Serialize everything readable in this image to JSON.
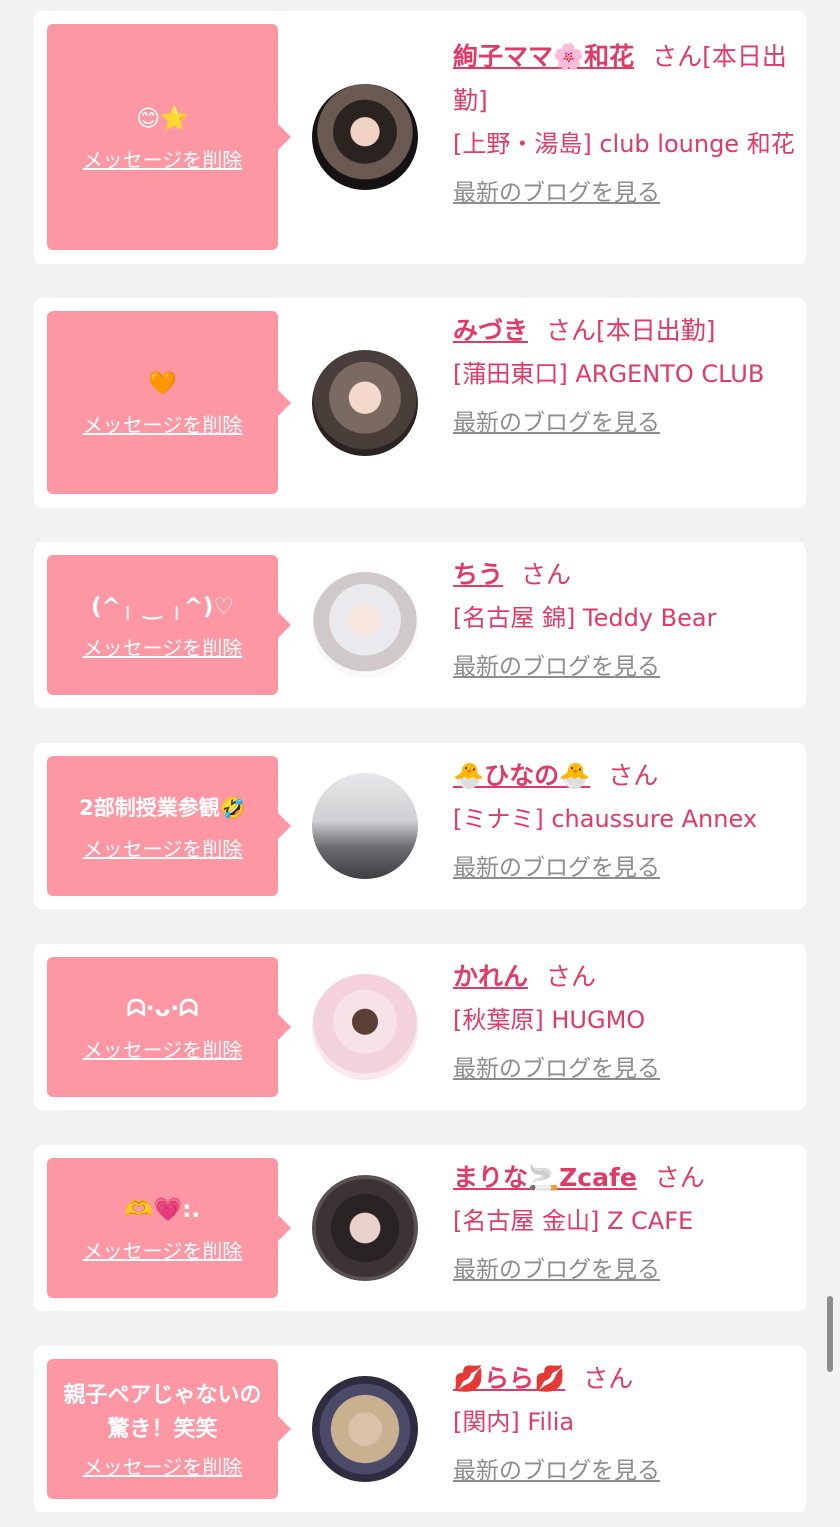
{
  "delete_label": "メッセージを削除",
  "blog_label": "最新のブログを見る",
  "suffix": "さん",
  "colors": {
    "bubble": "#fe97a4",
    "accent": "#e03a66",
    "link_gray": "#8d8d8d",
    "background": "#f2f2f2"
  },
  "cards": [
    {
      "message": "😊⭐",
      "name": "絢子ママ🌸和花",
      "status": "[本日出勤]",
      "shop": "[上野・湯島] club lounge 和花"
    },
    {
      "message": "🧡",
      "name": "みづき",
      "status": "[本日出勤]",
      "shop": "[蒲田東口] ARGENTO CLUB"
    },
    {
      "message": "(^╷ ‿ ╷^)♡",
      "name": "ちう",
      "status": "",
      "shop": "[名古屋 錦] Teddy Bear"
    },
    {
      "message": "2部制授業参観🤣",
      "name": "🐣ひなの🐣",
      "status": "",
      "shop": "[ミナミ] chaussure Annex"
    },
    {
      "message": "ᗣ·ᴗ·ᗣ",
      "name": "かれん",
      "status": "",
      "shop": "[秋葉原] HUGMO"
    },
    {
      "message": "🫶💗:.",
      "name": "まりな🚬Zcafe",
      "status": "",
      "shop": "[名古屋 金山] Z CAFE"
    },
    {
      "message": "親子ペアじゃないの驚き！笑笑",
      "name": "💋らら💋",
      "status": "",
      "shop": "[関内] Filia"
    }
  ]
}
